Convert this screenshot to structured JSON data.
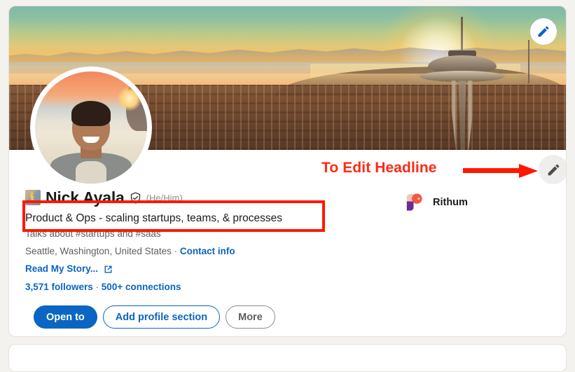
{
  "profile": {
    "name": "Nick Ayala",
    "pronouns": "(He/Him)",
    "headline": "Product & Ops - scaling startups, teams, & processes",
    "talks_about": "Talks about #startups and #saas",
    "location": "Seattle, Washington, United States",
    "location_separator": " · ",
    "contact_info_label": "Contact info",
    "website_label": "Read My Story...",
    "followers": "3,571 followers",
    "stats_separator": " · ",
    "connections": "500+ connections",
    "name_badge_icon": "open-to-work-frame-icon",
    "verified_icon": "verified-shield-icon",
    "external_link_icon": "external-link-icon"
  },
  "current_company": {
    "name": "Rithum",
    "logo_icon": "rithum-logo-icon",
    "logo_colors": {
      "purple": "#6b2d8f",
      "pink": "#f6c3bd",
      "coral": "#f05a40"
    }
  },
  "buttons": {
    "open_to": "Open to",
    "add_profile_section": "Add profile section",
    "more": "More"
  },
  "cover": {
    "edit_icon": "pencil-edit-icon",
    "scene": "seattle-sunset-space-needle"
  },
  "headline_edit": {
    "edit_icon": "pencil-edit-icon"
  },
  "annotation": {
    "text": "To Edit Headline",
    "arrow_icon": "right-arrow-icon",
    "color": "#ff2a16",
    "box_color": "#ff1800"
  },
  "theme": {
    "link_blue": "#0a66c2",
    "page_background": "#f4f2ee",
    "card_background": "#ffffff",
    "text_primary": "#1b1b1b",
    "text_secondary": "#5e5e5e"
  }
}
